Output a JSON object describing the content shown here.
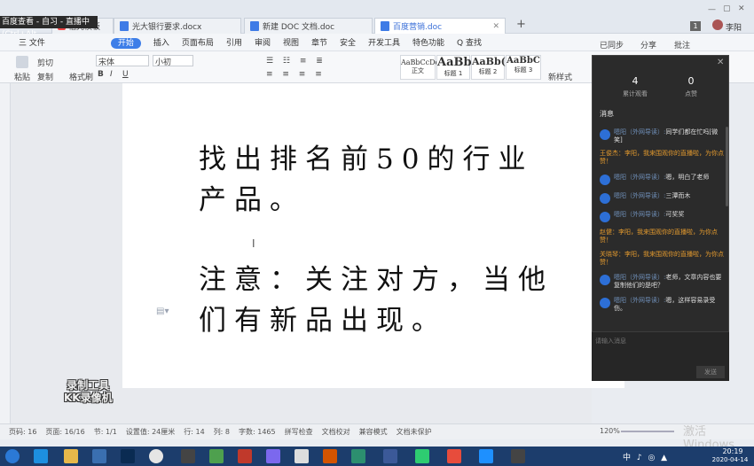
{
  "window": {
    "recording_banner": "百度查看 - 自习 - 直播中 (Ctrl+Alt...",
    "app_label": "稻壳模板"
  },
  "tabs": [
    {
      "label": "光大银行要求.docx"
    },
    {
      "label": "新建 DOC 文档.doc"
    },
    {
      "label": "百度营销.doc"
    }
  ],
  "titlebar": {
    "badge": "1",
    "user": "李阳",
    "add": "+"
  },
  "menu": {
    "file": "三 文件",
    "items": [
      "开始",
      "插入",
      "页面布局",
      "引用",
      "审阅",
      "视图",
      "章节",
      "安全",
      "开发工具",
      "特色功能"
    ],
    "active": "开始",
    "search": "Q 查找",
    "right": [
      "已同步",
      "分享",
      "批注"
    ]
  },
  "ribbon": {
    "paste": "粘贴",
    "cut": "剪切",
    "copy": "复制",
    "format_painter": "格式刷",
    "font": "宋体",
    "font_size": "小初",
    "styles": [
      {
        "preview": "AaBbCcDd",
        "label": "正文"
      },
      {
        "preview": "AaBb",
        "label": "标题 1"
      },
      {
        "preview": "AaBb(",
        "label": "标题 2"
      },
      {
        "preview": "AaBbC",
        "label": "标题 3"
      }
    ],
    "new_style": "新样式"
  },
  "document": {
    "lines": [
      "找出排名前50的行业",
      "产品。",
      "注意：关注对方，当他",
      "们有新品出现。"
    ]
  },
  "chat": {
    "stats": [
      {
        "value": "4",
        "label": "累计观看"
      },
      {
        "value": "0",
        "label": "点赞"
      }
    ],
    "section": "消息",
    "messages": [
      {
        "type": "user",
        "name": "嗯阳（外网导读）:",
        "text": "同学们都在忙吗[微笑]"
      },
      {
        "type": "sys",
        "text": "王俊杰：李阳，我来围观你的直播啦，为你点赞！"
      },
      {
        "type": "user",
        "name": "嗯阳（外网导读）:",
        "text": "嗯，明白了老师"
      },
      {
        "type": "user",
        "name": "嗯阳（外网导读）:",
        "text": "三潭而木"
      },
      {
        "type": "user",
        "name": "嗯阳（外网导读）:",
        "text": "可奖奖"
      },
      {
        "type": "sys",
        "text": "赵健：李阳，我来围观你的直播啦，为你点赞！"
      },
      {
        "type": "sys",
        "text": "关晓琴：李阳，我来围观你的直播啦，为你点赞！"
      },
      {
        "type": "user",
        "name": "嗯阳（外网导读）:",
        "text": "老师，文章内容也要复制他们的是吧？"
      },
      {
        "type": "user",
        "name": "嗯阳（外网导读）:",
        "text": "嗯，这样容易录受伤。"
      }
    ],
    "input_placeholder": "请输入消息",
    "send": "发送"
  },
  "status": {
    "items": [
      "页码: 16",
      "页面: 16/16",
      "节: 1/1",
      "设置值: 24厘米",
      "行: 14",
      "列: 8",
      "字数: 1465",
      "拼写检查",
      "文档校对",
      "兼容模式",
      "文档未保护"
    ],
    "zoom": "120%"
  },
  "watermark": {
    "line1": "录制工具",
    "line2": "KK录像机"
  },
  "activate": "激活 Windows",
  "clock": {
    "time": "20:19",
    "date": "2020-04-14"
  }
}
